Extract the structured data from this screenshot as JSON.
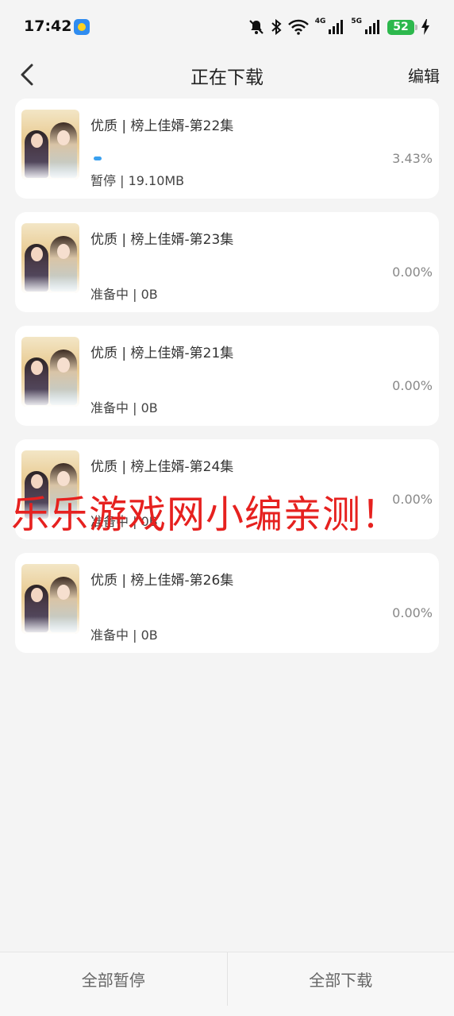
{
  "status_bar": {
    "time": "17:42",
    "net1_label": "4G",
    "net2_label": "5G",
    "battery": "52"
  },
  "header": {
    "title": "正在下载",
    "edit_label": "编辑"
  },
  "downloads": [
    {
      "title": "优质 | 榜上佳婿-第22集",
      "status": "暂停 | 19.10MB",
      "percent": "3.43%",
      "progress": 0.0343
    },
    {
      "title": "优质 | 榜上佳婿-第23集",
      "status": "准备中 | 0B",
      "percent": "0.00%",
      "progress": 0
    },
    {
      "title": "优质 | 榜上佳婿-第21集",
      "status": "准备中 | 0B",
      "percent": "0.00%",
      "progress": 0
    },
    {
      "title": "优质 | 榜上佳婿-第24集",
      "status": "准备中 | 0B",
      "percent": "0.00%",
      "progress": 0
    },
    {
      "title": "优质 | 榜上佳婿-第26集",
      "status": "准备中 | 0B",
      "percent": "0.00%",
      "progress": 0
    }
  ],
  "watermark": "乐乐游戏网小编亲测！",
  "bottom": {
    "pause_all": "全部暂停",
    "download_all": "全部下载"
  },
  "colors": {
    "accent": "#3aa0ef",
    "watermark": "#e6211f",
    "battery": "#2db84d"
  }
}
